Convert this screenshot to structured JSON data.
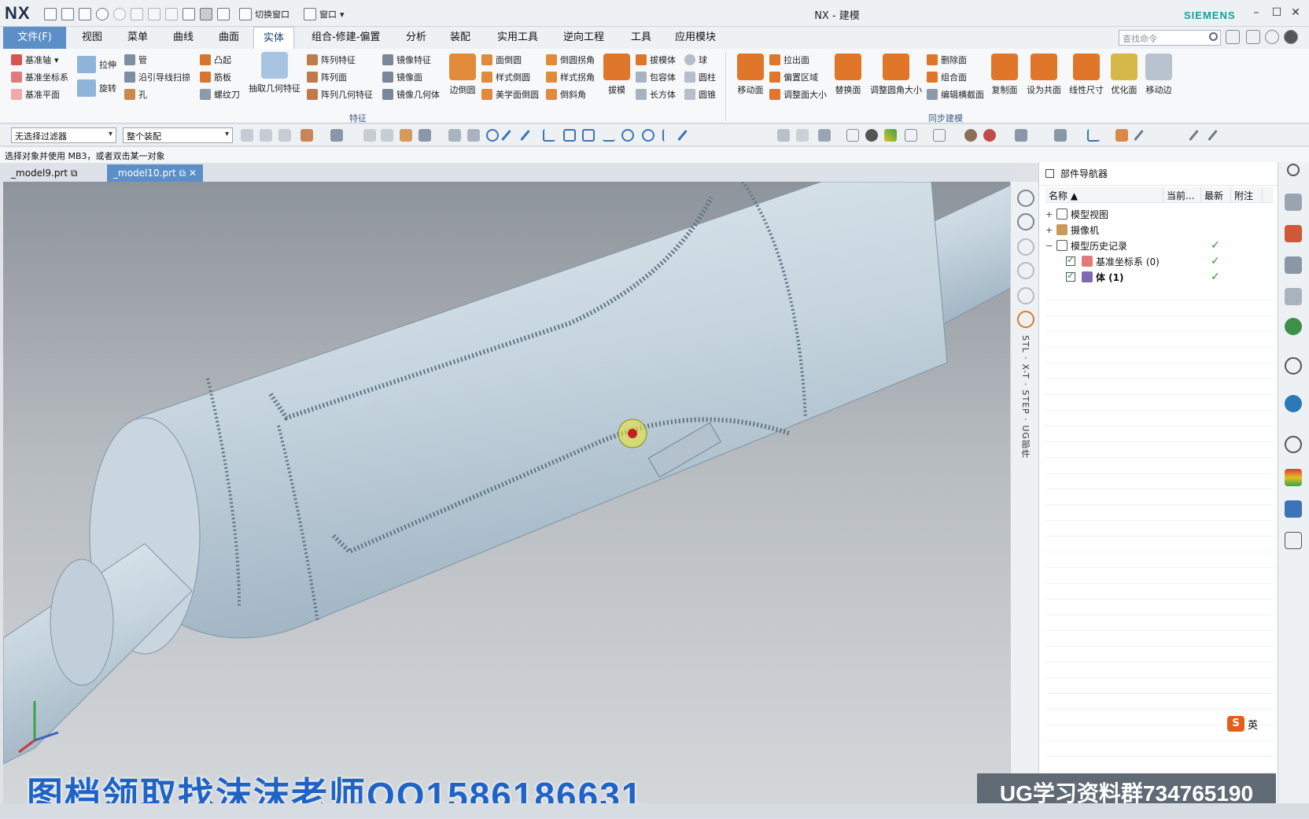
{
  "window": {
    "app_logo": "NX",
    "title": "NX - 建模",
    "brand": "SIEMENS",
    "switch_window": "切换窗口",
    "window_menu": "窗口"
  },
  "ribbon_tabs": [
    {
      "label": "文件(F)"
    },
    {
      "label": "视图"
    },
    {
      "label": "菜单"
    },
    {
      "label": "曲线"
    },
    {
      "label": "曲面"
    },
    {
      "label": "实体"
    },
    {
      "label": "组合-修建-偏置"
    },
    {
      "label": "分析"
    },
    {
      "label": "装配"
    },
    {
      "label": "实用工具"
    },
    {
      "label": "逆向工程"
    },
    {
      "label": "工具"
    },
    {
      "label": "应用模块"
    }
  ],
  "active_tab": "实体",
  "search_placeholder": "查找命令",
  "ribbon": {
    "datum": [
      "基准轴",
      "基准坐标系",
      "基准平面"
    ],
    "extrude": "拉伸",
    "revolve": "旋转",
    "tube": [
      "管",
      "沿引导线扫掠",
      "孔"
    ],
    "emboss": [
      "凸起",
      "筋板",
      "螺纹刀"
    ],
    "extract": "抽取几何特征",
    "pattern": [
      "阵列特征",
      "阵列面",
      "阵列几何特征"
    ],
    "mirror": [
      "镜像特征",
      "镜像面",
      "镜像几何体"
    ],
    "edge_blend": "边倒圆",
    "face_blend": [
      "面倒圆",
      "样式倒圆",
      "美学面倒圆"
    ],
    "chamfer": [
      "倒圆拐角",
      "样式拐角",
      "倒斜角"
    ],
    "draft": "拔模",
    "draft_body": [
      "拔模体",
      "包容体",
      "长方体"
    ],
    "primitives": [
      "球",
      "圆柱",
      "圆锥"
    ],
    "move_face": "移动面",
    "pull": [
      "拉出面",
      "偏置区域",
      "调整面大小"
    ],
    "replace_face": "替换面",
    "resize_blend": "调整圆角大小",
    "delete": [
      "删除面",
      "组合面",
      "编辑横截面"
    ],
    "copy_face": "复制面",
    "coplanar": "设为共面",
    "linear_dim": "线性尺寸",
    "optimize": "优化面",
    "move_edge": "移动边",
    "group_feature": "特征",
    "group_sync": "同步建模"
  },
  "selection": {
    "filter": "无选择过滤器",
    "scope": "整个装配"
  },
  "status_text": "选择对象并使用 MB3，或者双击某一对象",
  "doc_tabs": [
    {
      "label": "_model9.prt"
    },
    {
      "label": "_model10.prt"
    }
  ],
  "active_doc": "_model10.prt",
  "side_labels": [
    "STL",
    "X-T",
    "STEP",
    "UG部件"
  ],
  "navigator": {
    "title": "部件导航器",
    "columns": [
      "名称",
      "当前...",
      "最新",
      "附注"
    ],
    "rows": [
      {
        "label": "模型视图",
        "expand": "+"
      },
      {
        "label": "摄像机",
        "expand": "+"
      },
      {
        "label": "模型历史记录",
        "expand": "−"
      },
      {
        "label": "基准坐标系 (0)"
      },
      {
        "label": "体 (1)"
      }
    ]
  },
  "ime": {
    "logo": "S",
    "lang": "英"
  },
  "overlay": {
    "left": "图档领取找沫沫老师QQ1586186631",
    "right": "UG学习资料群734765190"
  },
  "colors": {
    "file_tab": "#5c8fc7",
    "brand": "#129f96",
    "overlay_text": "#1f63c6",
    "check": "#1a9b1a"
  }
}
